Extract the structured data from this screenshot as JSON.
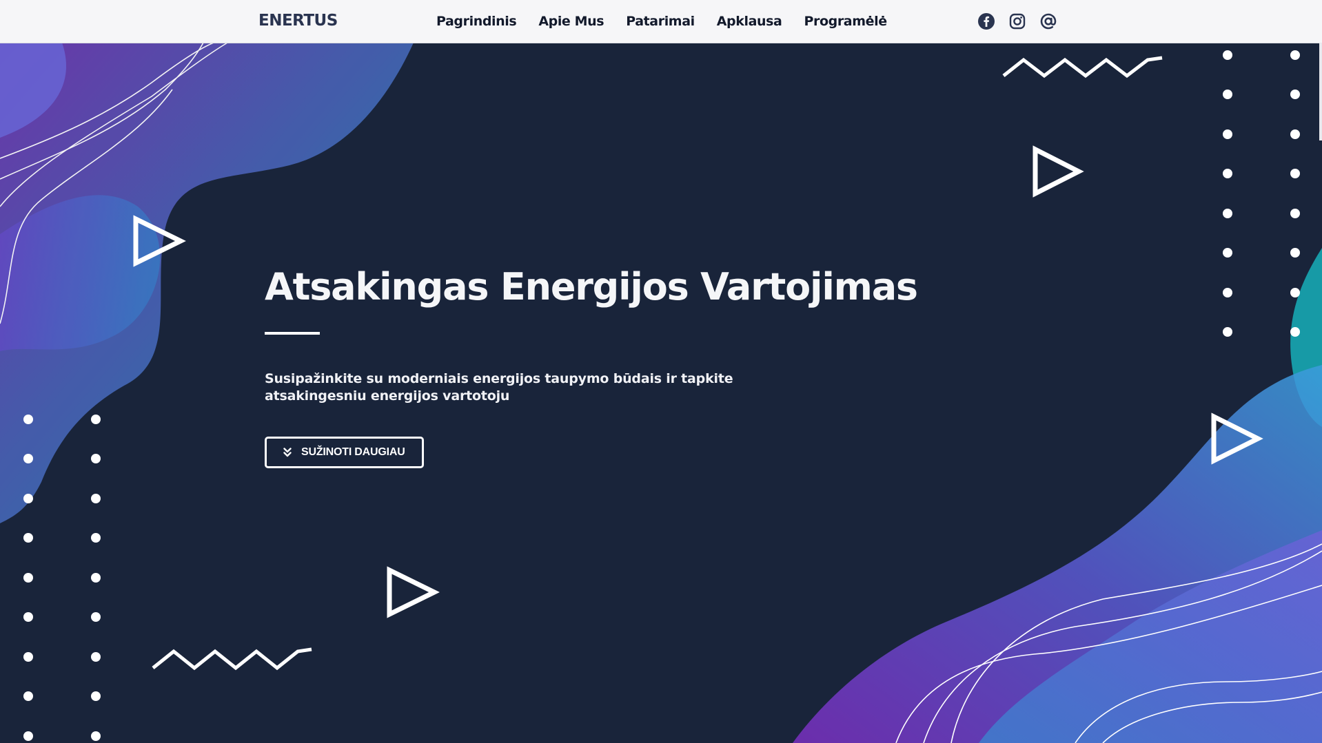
{
  "header": {
    "brand": "ENERTUS",
    "nav": [
      {
        "label": "Pagrindinis"
      },
      {
        "label": "Apie Mus"
      },
      {
        "label": "Patarimai"
      },
      {
        "label": "Apklausa"
      },
      {
        "label": "Programėlė"
      }
    ],
    "social_icons": [
      "facebook-icon",
      "instagram-icon",
      "at-sign-icon"
    ]
  },
  "hero": {
    "title": "Atsakingas Energijos Vartojimas",
    "subtitle": "Susipažinkite su moderniais energijos taupymo būdais ir tapkite atsakingesniu energijos vartotoju",
    "cta_label": "SUŽINOTI DAUGIAU",
    "cta_icon": "double-chevron-down-icon"
  },
  "colors": {
    "background": "#19243a",
    "topbar": "#f6f6f8",
    "brand_text": "#2a3450",
    "purple": "#8b3fd6",
    "blue": "#3aa0dc",
    "teal": "#179aa6"
  }
}
